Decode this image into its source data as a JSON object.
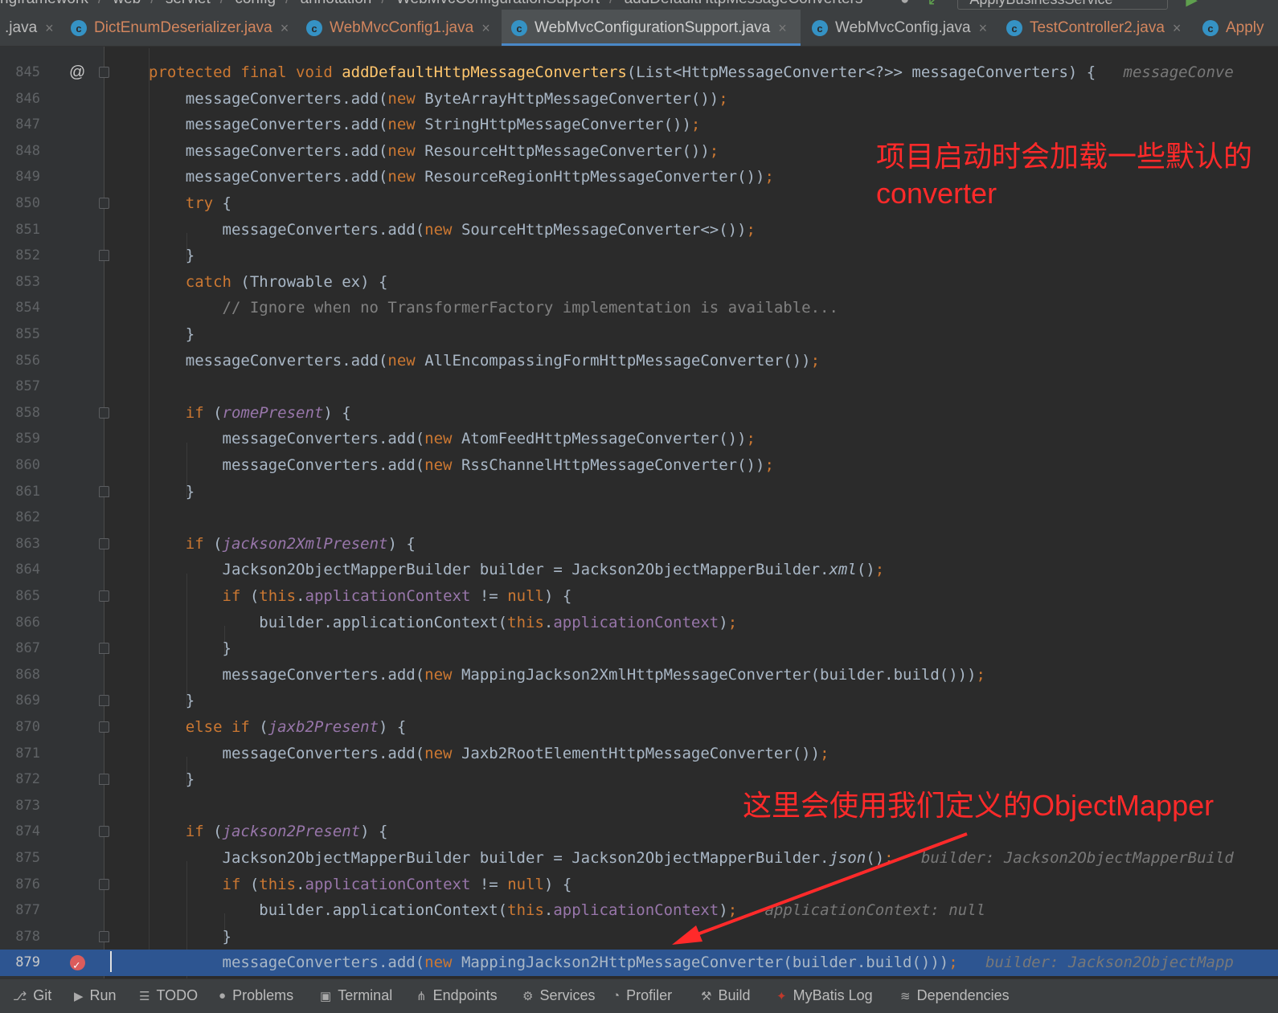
{
  "breadcrumb": [
    "ngframework",
    "web",
    "servlet",
    "config",
    "annotation",
    "WebMvcConfigurationSupport",
    "addDefaultHttpMessageConverters"
  ],
  "run_config": "ApplyBusinessService",
  "tabs": [
    {
      "label": ".java",
      "icon": "class-icon",
      "state": "partial"
    },
    {
      "label": "DictEnumDeserializer.java",
      "icon": "class-icon",
      "state": "modified"
    },
    {
      "label": "WebMvcConfig1.java",
      "icon": "class-icon",
      "state": "modified"
    },
    {
      "label": "WebMvcConfigurationSupport.java",
      "icon": "class-icon",
      "state": "active"
    },
    {
      "label": "WebMvcConfig.java",
      "icon": "class-icon",
      "state": "normal"
    },
    {
      "label": "TestController2.java",
      "icon": "class-icon",
      "state": "modified"
    },
    {
      "label": "Apply",
      "icon": "class-icon",
      "state": "partial"
    }
  ],
  "editor": {
    "line_numbers": [
      "845",
      "846",
      "847",
      "848",
      "849",
      "850",
      "851",
      "852",
      "853",
      "854",
      "855",
      "856",
      "857",
      "858",
      "859",
      "860",
      "861",
      "862",
      "863",
      "864",
      "865",
      "866",
      "867",
      "868",
      "869",
      "870",
      "871",
      "872",
      "873",
      "874",
      "875",
      "876",
      "877",
      "878",
      "879"
    ],
    "current_line": "879",
    "inline_hints": {
      "l845": "messageConve",
      "l875": "builder: Jackson2ObjectMapperBuild",
      "l877": "applicationContext: null",
      "l879": "builder: Jackson2ObjectMapp"
    }
  },
  "annotations": {
    "top": "项目启动时会加载一些默认的converter",
    "bottom": "这里会使用我们定义的ObjectMapper"
  },
  "colors": {
    "keyword": "#cc7832",
    "method": "#ffc66d",
    "field": "#9876aa",
    "annotation_red": "#ff2a2a",
    "current_line": "#2d5591"
  },
  "bottom_toolbar": [
    "Git",
    "Run",
    "TODO",
    "Problems",
    "Terminal",
    "Endpoints",
    "Services",
    "Profiler",
    "Build",
    "MyBatis Log",
    "Dependencies"
  ]
}
